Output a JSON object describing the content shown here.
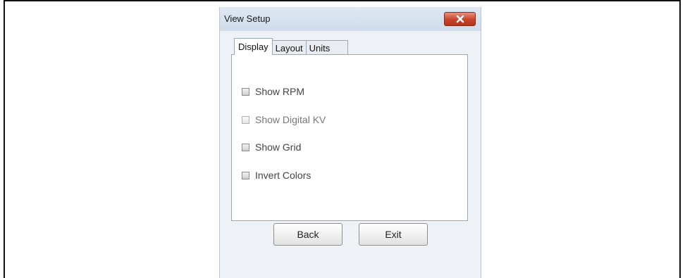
{
  "window": {
    "title": "View Setup",
    "close_icon": "close-icon",
    "close_color": "#c8432a"
  },
  "tabs": [
    {
      "label": "Display",
      "active": true
    },
    {
      "label": "Layout",
      "active": false
    },
    {
      "label": "Units",
      "active": false
    }
  ],
  "options": [
    {
      "label": "Show RPM",
      "checked": false,
      "enabled": true
    },
    {
      "label": "Show Digital KV",
      "checked": false,
      "enabled": false
    },
    {
      "label": "Show Grid",
      "checked": false,
      "enabled": true
    },
    {
      "label": "Invert Colors",
      "checked": false,
      "enabled": true
    }
  ],
  "buttons": {
    "back": "Back",
    "exit": "Exit"
  }
}
